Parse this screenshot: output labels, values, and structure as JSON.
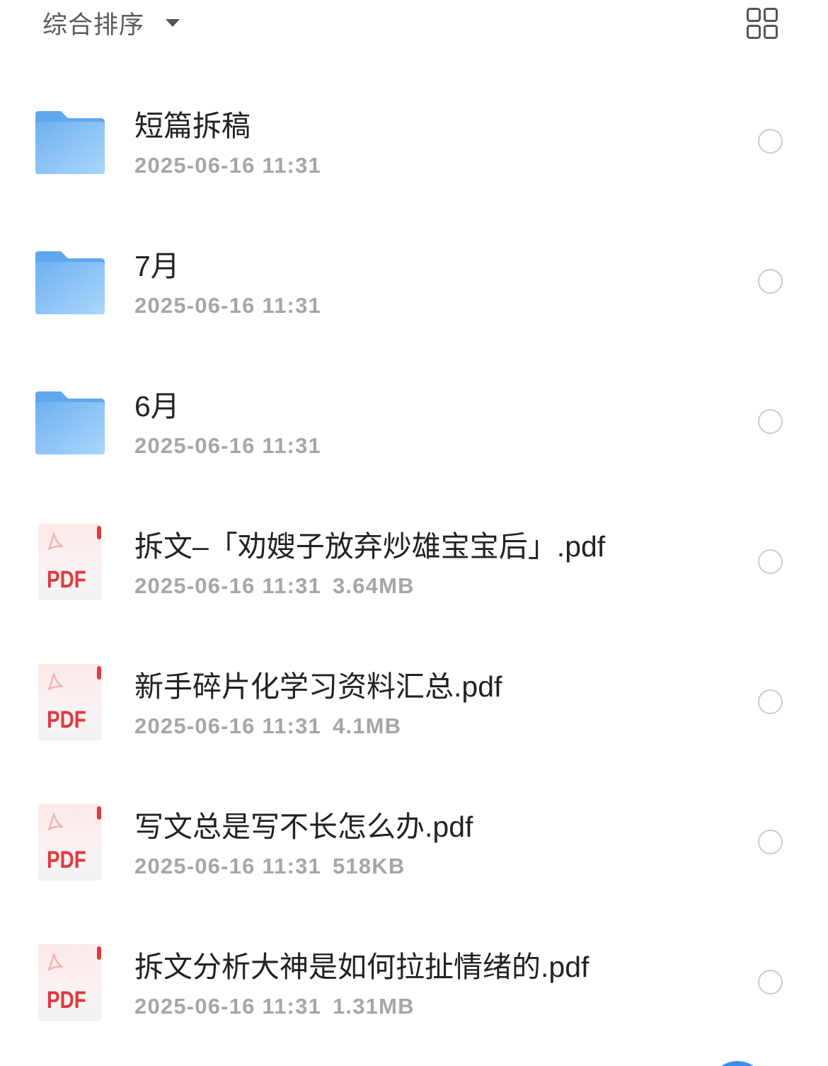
{
  "header": {
    "sort_label": "综合排序",
    "sort_caret_icon": "caret-down-icon",
    "view_mode_icon": "grid-view-icon"
  },
  "icons": {
    "folder": "folder-icon",
    "pdf": "pdf-file-icon",
    "pdf_label": "PDF",
    "select": "radio-unchecked-icon"
  },
  "files": [
    {
      "icon": "folder-icon",
      "name": "短篇拆稿",
      "modified": "2025-06-16 11:31"
    },
    {
      "icon": "folder-icon",
      "name": "7月",
      "modified": "2025-06-16 11:31"
    },
    {
      "icon": "folder-icon",
      "name": "6月",
      "modified": "2025-06-16 11:31"
    },
    {
      "icon": "pdf-file-icon",
      "name": "拆文–「劝嫂子放弃炒雄宝宝后」.pdf",
      "modified": "2025-06-16 11:31",
      "size": "3.64MB"
    },
    {
      "icon": "pdf-file-icon",
      "name": "新手碎片化学习资料汇总.pdf",
      "modified": "2025-06-16 11:31",
      "size": "4.1MB"
    },
    {
      "icon": "pdf-file-icon",
      "name": "写文总是写不长怎么办.pdf",
      "modified": "2025-06-16 11:31",
      "size": "518KB"
    },
    {
      "icon": "pdf-file-icon",
      "name": "拆文分析大神是如何拉扯情绪的.pdf",
      "modified": "2025-06-16 11:31",
      "size": "1.31MB"
    }
  ],
  "colors": {
    "title_text": "#222222",
    "meta_text": "#a6a6a6",
    "folder_blue": "#6fb0f0",
    "pdf_red": "#e0393e",
    "radio_border": "#cbcbcb",
    "fab_blue": "#3a8ef0"
  },
  "fab": {
    "icon": "floating-action-button-icon"
  }
}
